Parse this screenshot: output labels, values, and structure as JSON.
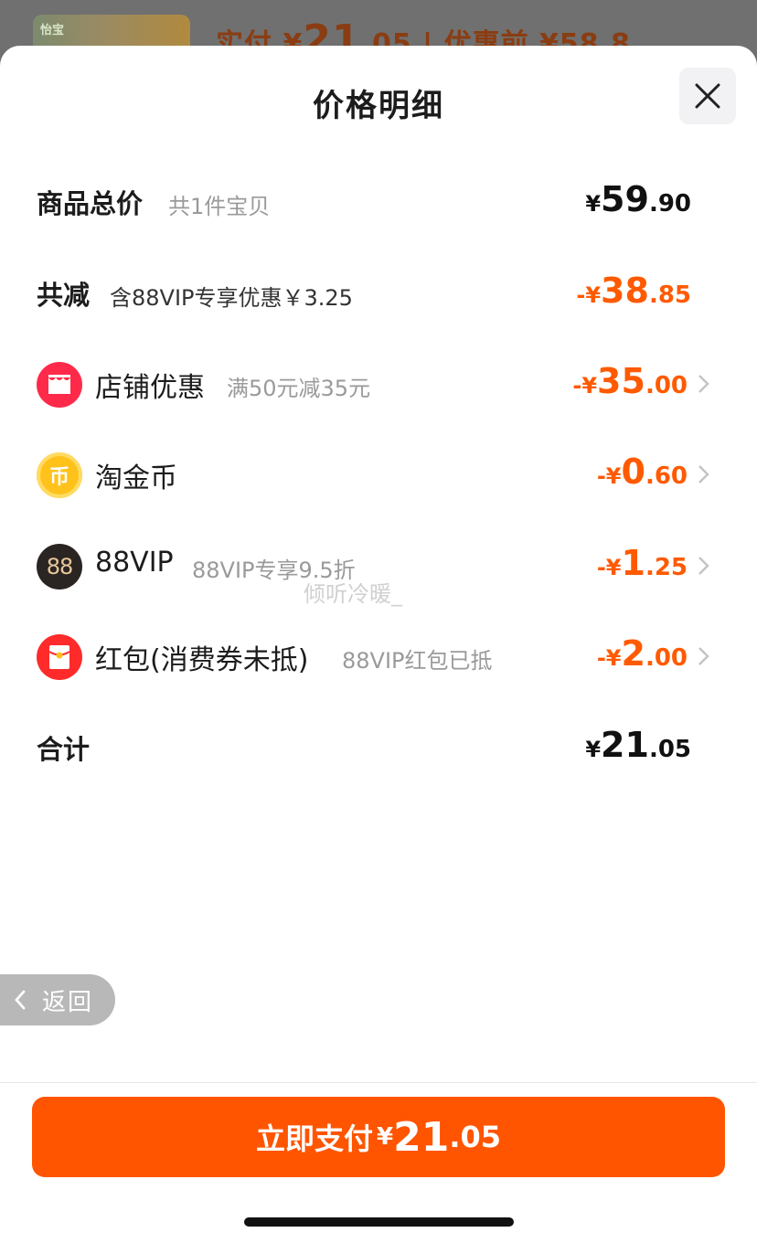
{
  "backdrop": {
    "thumb_tag": "怡宝",
    "paid_label": "实付 ¥",
    "paid_int": "21",
    "paid_dec": ".05",
    "separator": "|",
    "before_label": "优惠前 ¥58.8"
  },
  "sheet": {
    "title": "价格明细"
  },
  "rows": {
    "total": {
      "label": "商品总价",
      "sub": "共1件宝贝",
      "yen": "¥",
      "int": "59",
      "dec": ".90"
    },
    "reduce": {
      "label": "共减",
      "sub": "含88VIP专享优惠￥3.25",
      "yen": "-¥",
      "int": "38",
      "dec": ".85"
    },
    "shop": {
      "label": "店铺优惠",
      "sub": "满50元减35元",
      "yen": "-¥",
      "int": "35",
      "dec": ".00",
      "icon": "shop-icon"
    },
    "coin": {
      "label": "淘金币",
      "yen": "-¥",
      "int": "0",
      "dec": ".60",
      "icon": "coin-icon",
      "glyph": "币"
    },
    "vip": {
      "label": "88VIP",
      "sub": "88VIP专享9.5折",
      "yen": "-¥",
      "int": "1",
      "dec": ".25",
      "icon": "vip-icon",
      "glyph": "88"
    },
    "redpacket": {
      "label": "红包(消费券未抵)",
      "sub": "88VIP红包已抵",
      "yen": "-¥",
      "int": "2",
      "dec": ".00",
      "icon": "red-packet-icon"
    },
    "sum": {
      "label": "合计",
      "yen": "¥",
      "int": "21",
      "dec": ".05"
    }
  },
  "watermark": "倾听冷暖_",
  "back_button": {
    "label": "返回"
  },
  "pay_button": {
    "label": "立即支付",
    "yen": "¥",
    "int": "21",
    "dec": ".05"
  },
  "colors": {
    "accent": "#ff5500",
    "discount": "#ff5a00"
  }
}
